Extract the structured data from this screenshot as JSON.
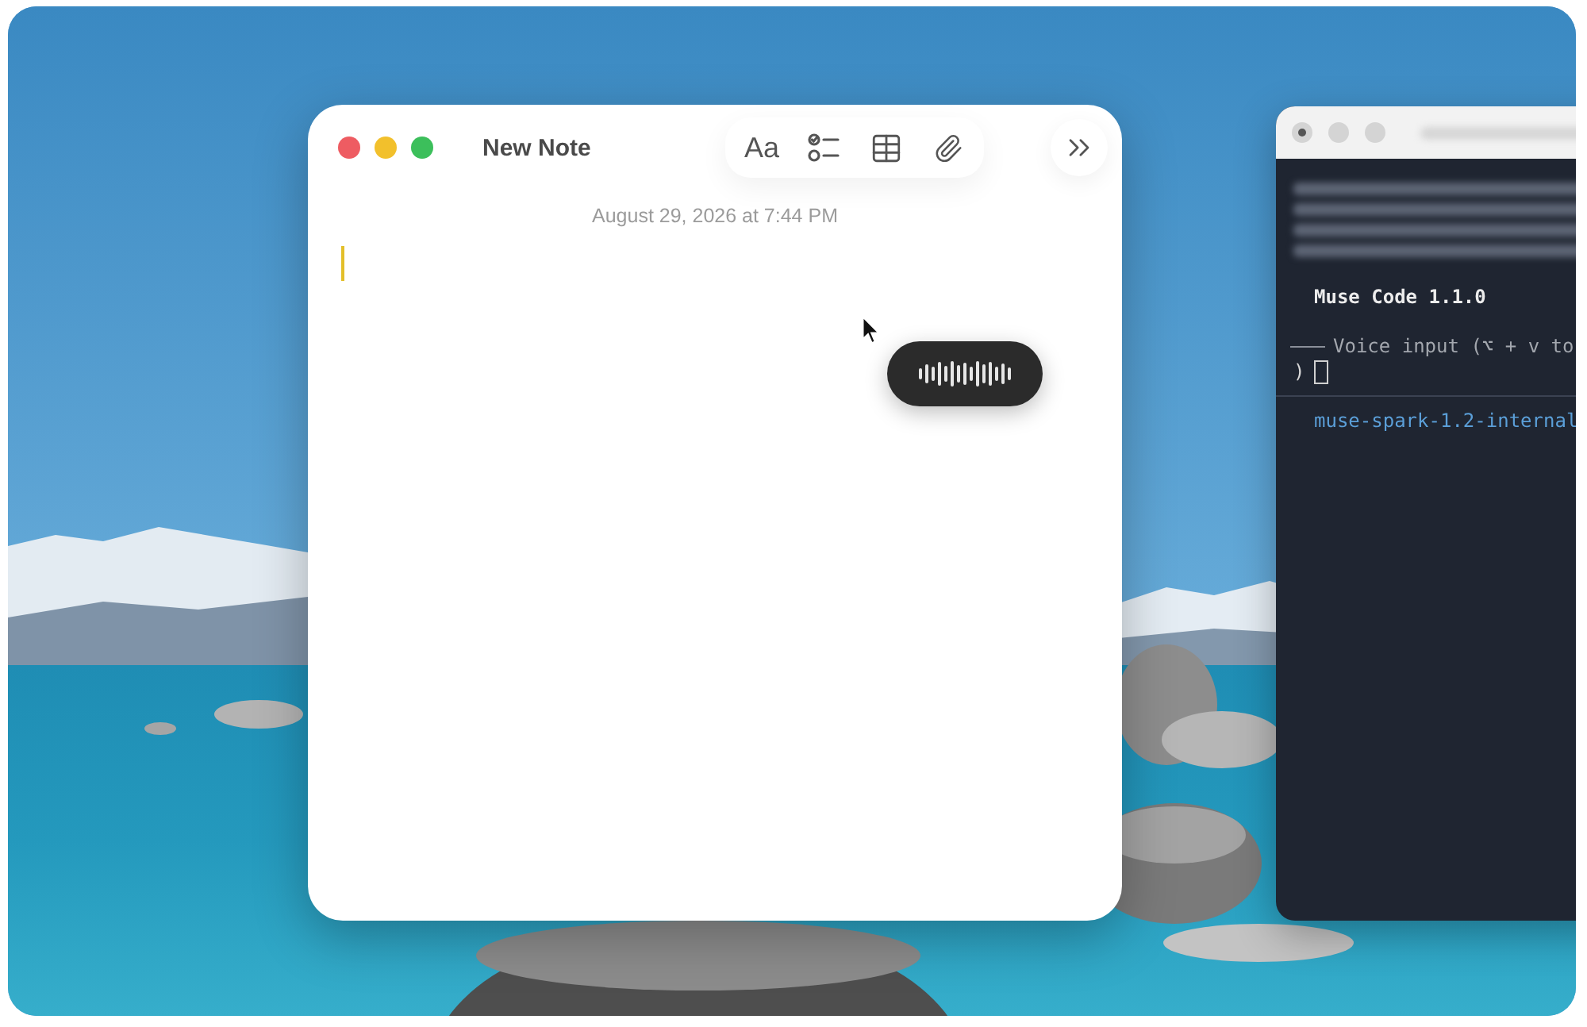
{
  "notes_window": {
    "window_controls": [
      {
        "color": "#ee5c62"
      },
      {
        "color": "#f2c02c"
      },
      {
        "color": "#3cbf5b"
      }
    ],
    "title": "New Note",
    "toolbar": [
      {
        "kind": "format",
        "label": "Aa"
      },
      {
        "kind": "checklist"
      },
      {
        "kind": "table"
      },
      {
        "kind": "attachment"
      }
    ],
    "show_more": true,
    "date": "August 29, 2026 at 7:44 PM",
    "caret_visible": true
  },
  "voice_indicator": {
    "active": true
  },
  "terminal_window": {
    "focused": false,
    "window_controls": [
      {
        "edited": true
      },
      {
        "edited": false
      },
      {
        "edited": false
      }
    ],
    "lines": [
      {
        "kind": "heading",
        "text": "Muse Code 1.1.0"
      },
      {
        "kind": "hint",
        "text": "Voice input (⌥ + v to"
      },
      {
        "kind": "prompt",
        "text": ")"
      },
      {
        "kind": "status",
        "text": "muse-spark-1.2-internal"
      }
    ]
  }
}
